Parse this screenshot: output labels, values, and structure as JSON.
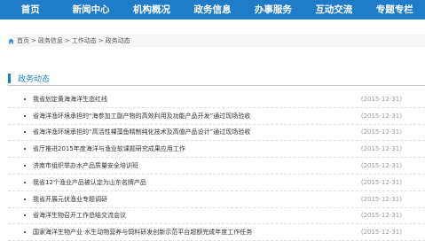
{
  "nav": {
    "items": [
      {
        "label": "首页"
      },
      {
        "label": "新闻中心"
      },
      {
        "label": "机构概况"
      },
      {
        "label": "政务信息"
      },
      {
        "label": "办事服务"
      },
      {
        "label": "互动交流"
      },
      {
        "label": "专题专栏"
      }
    ]
  },
  "breadcrumb": {
    "icon": "home-icon",
    "items": [
      {
        "label": "首页"
      },
      {
        "label": "政务信息"
      },
      {
        "label": "工作动态"
      }
    ],
    "current": "政务动态",
    "separator": ">"
  },
  "section": {
    "title": "政务动态"
  },
  "news": [
    {
      "title": "我省划定黄海海洋生态红线",
      "date": "(2015-12-31)"
    },
    {
      "title": "省海洋渔环境承担的“海参加工副产物的高效利用及功能产品开发”通过现场验收",
      "date": "(2015-12-31)"
    },
    {
      "title": "省海洋渔环境承担的“高活性裸藻鱼精制纯化技术及高值产品设计”通过现场验收",
      "date": "(2015-12-31)"
    },
    {
      "title": "省厅推进2015年度海洋与渔业软课题研究成果应用工作",
      "date": "(2015-12-31)"
    },
    {
      "title": "济南市组织举办水产品质量安全培训班",
      "date": "(2015-12-31)"
    },
    {
      "title": "我省12个渔业产品被认定为山东名牌产品",
      "date": "(2015-12-31)"
    },
    {
      "title": "我省开展元伏渔业专题调研",
      "date": "(2015-12-31)"
    },
    {
      "title": "省海洋生物召开工作总结交流会议",
      "date": "(2015-12-31)"
    },
    {
      "title": "国家海洋生物产业·水生动物营养与饲料研发创新示范平台超额完成年度工作任务",
      "date": "(2015-12-31)"
    }
  ],
  "colors": {
    "nav_bg": "#1f7cc8",
    "accent": "#1f7cc8",
    "date": "#9a9a9a"
  }
}
